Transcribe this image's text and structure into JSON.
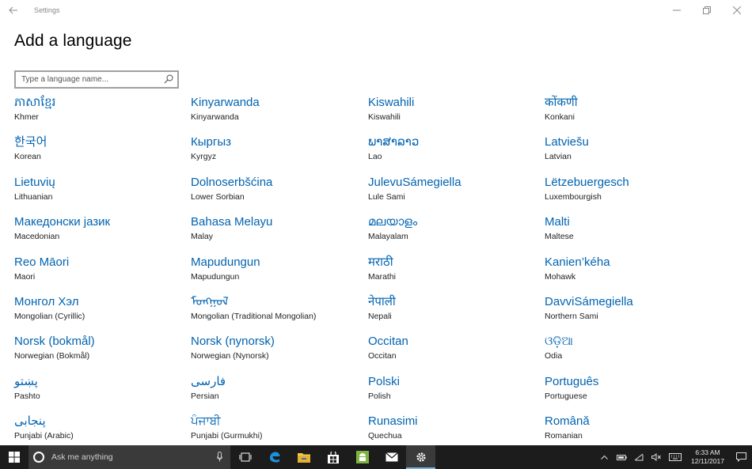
{
  "window": {
    "title": "Settings"
  },
  "page": {
    "title": "Add a language"
  },
  "search": {
    "placeholder": "Type a language name..."
  },
  "languages": [
    [
      "ភាសាខ្មែរ",
      "Khmer"
    ],
    [
      "Kinyarwanda",
      "Kinyarwanda"
    ],
    [
      "Kiswahili",
      "Kiswahili"
    ],
    [
      "कोंकणी",
      "Konkani"
    ],
    [
      "한국어",
      "Korean"
    ],
    [
      "Кыргыз",
      "Kyrgyz"
    ],
    [
      "ພາສາລາວ",
      "Lao"
    ],
    [
      "Latviešu",
      "Latvian"
    ],
    [
      "Lietuvių",
      "Lithuanian"
    ],
    [
      "Dolnoserbšćina",
      "Lower Sorbian"
    ],
    [
      "JulevuSámegiella",
      "Lule Sami"
    ],
    [
      "Lëtzebuergesch",
      "Luxembourgish"
    ],
    [
      "Македонски јазик",
      "Macedonian"
    ],
    [
      "Bahasa Melayu",
      "Malay"
    ],
    [
      "മലയാളം",
      "Malayalam"
    ],
    [
      "Malti",
      "Maltese"
    ],
    [
      "Reo Māori",
      "Maori"
    ],
    [
      "Mapudungun",
      "Mapudungun"
    ],
    [
      "मराठी",
      "Marathi"
    ],
    [
      "Kanien’kéha",
      "Mohawk"
    ],
    [
      "Монгол Хэл",
      "Mongolian (Cyrillic)"
    ],
    [
      "ᠮᠣᠩᠭᠣᠯ",
      "Mongolian (Traditional Mongolian)"
    ],
    [
      "नेपाली",
      "Nepali"
    ],
    [
      "DavviSámegiella",
      "Northern Sami"
    ],
    [
      "Norsk (bokmål)",
      "Norwegian (Bokmål)"
    ],
    [
      "Norsk (nynorsk)",
      "Norwegian (Nynorsk)"
    ],
    [
      "Occitan",
      "Occitan"
    ],
    [
      "ଓଡ଼ିଆ",
      "Odia"
    ],
    [
      "پښتو",
      "Pashto"
    ],
    [
      "فارسی",
      "Persian"
    ],
    [
      "Polski",
      "Polish"
    ],
    [
      "Português",
      "Portuguese"
    ],
    [
      "پنجابی",
      "Punjabi (Arabic)"
    ],
    [
      "ਪੰਜਾਬੀ",
      "Punjabi (Gurmukhi)"
    ],
    [
      "Runasimi",
      "Quechua"
    ],
    [
      "Română",
      "Romanian"
    ]
  ],
  "taskbar": {
    "search_text": "Ask me anything",
    "time": "6:33 AM",
    "date": "12/11/2017",
    "icons": [
      "windows-start-icon",
      "task-view-icon",
      "edge-icon",
      "file-explorer-icon",
      "store-icon",
      "android-app-icon",
      "mail-icon",
      "settings-gear-icon"
    ],
    "tray_icons": [
      "chevron-up-icon",
      "battery-icon",
      "network-icon",
      "volume-muted-icon",
      "keyboard-icon",
      "notification-icon"
    ]
  }
}
